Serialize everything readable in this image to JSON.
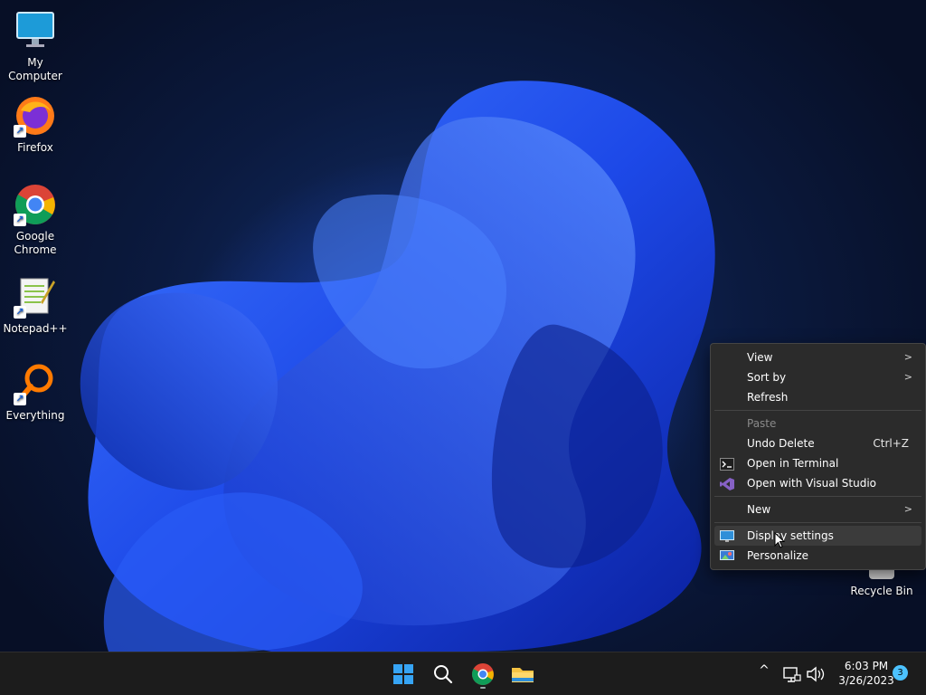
{
  "desktop": {
    "icons": [
      {
        "label": "My Computer",
        "icon": "monitor-icon"
      },
      {
        "label": "Firefox",
        "icon": "firefox-icon"
      },
      {
        "label": "Google\nChrome",
        "icon": "chrome-icon"
      },
      {
        "label": "Notepad++",
        "icon": "notepadpp-icon"
      },
      {
        "label": "Everything",
        "icon": "search-magnifier-icon"
      }
    ],
    "recycle_bin": {
      "label": "Recycle Bin",
      "icon": "recycle-bin-icon"
    }
  },
  "context_menu": {
    "items": [
      {
        "label": "View",
        "submenu": true
      },
      {
        "label": "Sort by",
        "submenu": true
      },
      {
        "label": "Refresh"
      },
      {
        "label": "Paste",
        "disabled": true
      },
      {
        "label": "Undo Delete",
        "shortcut": "Ctrl+Z"
      },
      {
        "label": "Open in Terminal",
        "icon": "terminal-icon"
      },
      {
        "label": "Open with Visual Studio",
        "icon": "visual-studio-icon"
      },
      {
        "label": "New",
        "submenu": true
      },
      {
        "label": "Display settings",
        "icon": "display-icon",
        "hover": true
      },
      {
        "label": "Personalize",
        "icon": "personalize-icon"
      }
    ],
    "chevron": ">"
  },
  "taskbar": {
    "apps": [
      "windows-start-icon",
      "search-icon",
      "chrome-icon",
      "file-explorer-icon"
    ],
    "tray": {
      "chevron": "^",
      "time": "6:03 PM",
      "date": "3/26/2023",
      "notification_count": "3"
    }
  },
  "colors": {
    "accent": "#4cc2ff",
    "menu_bg": "#2b2b2b",
    "taskbar_bg": "#1c1c1c"
  }
}
